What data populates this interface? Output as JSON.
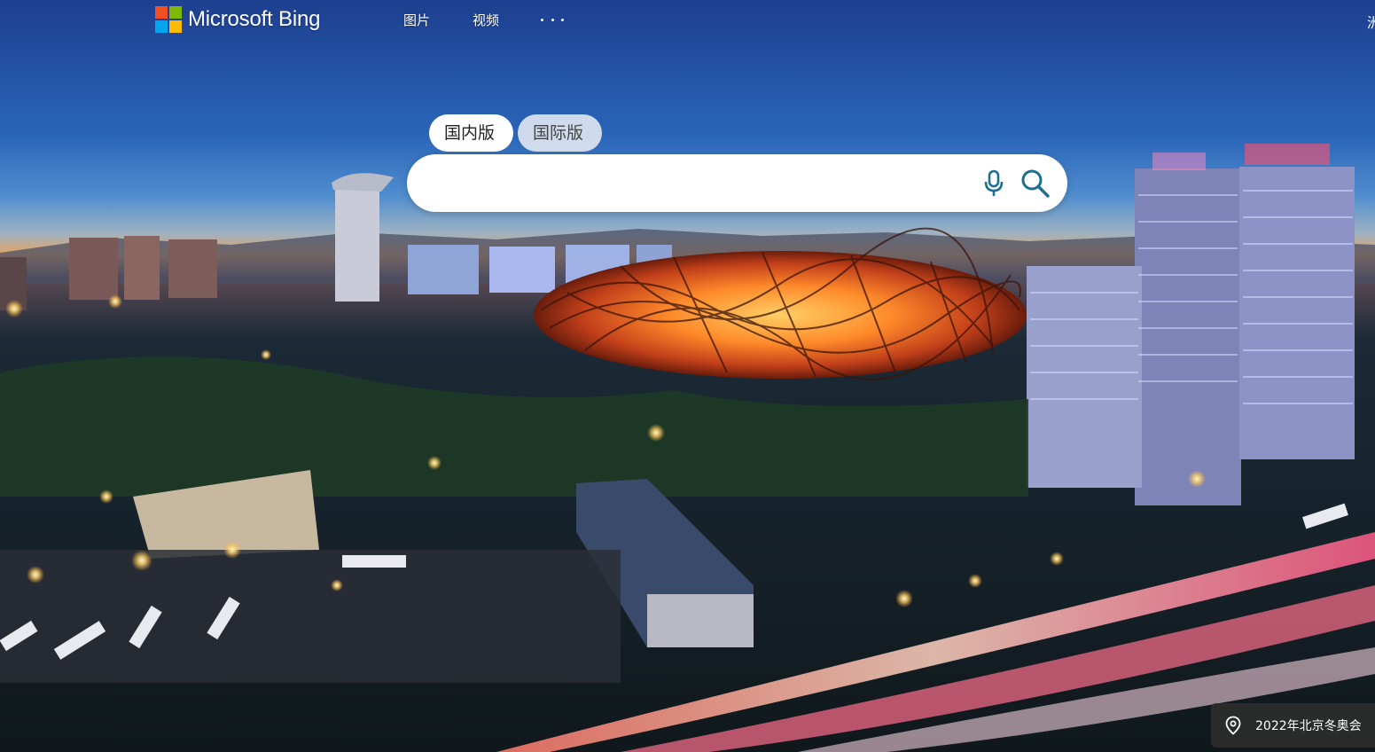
{
  "header": {
    "brand": "Microsoft Bing",
    "logo_colors": [
      "#f25022",
      "#7fba00",
      "#00a4ef",
      "#ffb900"
    ],
    "nav": [
      {
        "label": "图片"
      },
      {
        "label": "视频"
      }
    ],
    "more_icon": "more-horizontal-icon",
    "corner_text": "洲"
  },
  "scope_tabs": [
    {
      "label": "国内版",
      "selected": true
    },
    {
      "label": "国际版",
      "selected": false
    }
  ],
  "search": {
    "value": "",
    "placeholder": "",
    "mic_icon": "microphone-icon",
    "search_icon": "search-icon",
    "icon_color": "#1a6f93"
  },
  "image_info": {
    "icon": "location-pin-icon",
    "text": "2022年北京冬奥会"
  }
}
